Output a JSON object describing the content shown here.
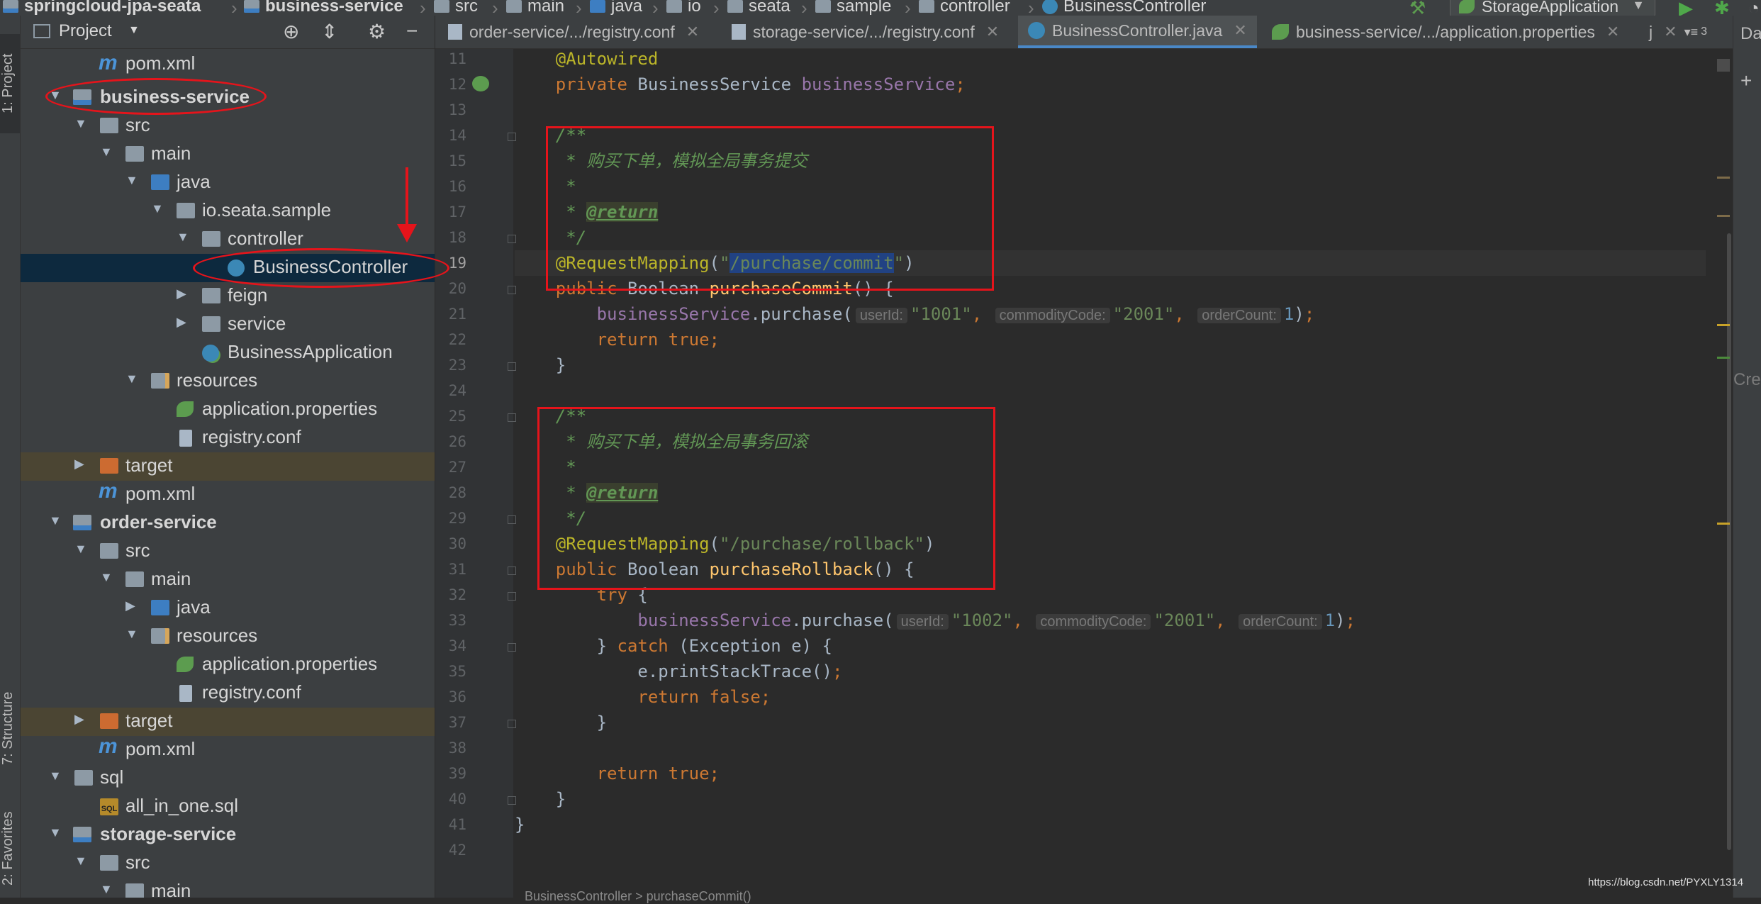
{
  "navbar": {
    "crumbs": [
      {
        "label": "springcloud-jpa-seata",
        "icon": "module-icon"
      },
      {
        "label": "business-service",
        "icon": "module-icon"
      },
      {
        "label": "src",
        "icon": "folder-icon"
      },
      {
        "label": "main",
        "icon": "folder-icon"
      },
      {
        "label": "java",
        "icon": "folder-icon"
      },
      {
        "label": "io",
        "icon": "package-icon"
      },
      {
        "label": "seata",
        "icon": "package-icon"
      },
      {
        "label": "sample",
        "icon": "package-icon"
      },
      {
        "label": "controller",
        "icon": "package-icon"
      },
      {
        "label": "BusinessController",
        "icon": "class-icon"
      }
    ],
    "run_config": "StorageApplication"
  },
  "left_strip": {
    "project_tab": "1: Project",
    "structure_tab": "7: Structure",
    "favorites_tab": "2: Favorites"
  },
  "project_panel": {
    "title": "Project",
    "tree": [
      {
        "label": "pom.xml",
        "icon": "maven-icon",
        "indent": 0
      },
      {
        "label": "business-service",
        "icon": "module-icon",
        "bold": true
      },
      {
        "label": "src",
        "icon": "folder-icon"
      },
      {
        "label": "main",
        "icon": "folder-icon"
      },
      {
        "label": "java",
        "icon": "source-folder-icon"
      },
      {
        "label": "io.seata.sample",
        "icon": "package-icon"
      },
      {
        "label": "controller",
        "icon": "package-icon"
      },
      {
        "label": "BusinessController",
        "icon": "class-icon",
        "selected": true
      },
      {
        "label": "feign",
        "icon": "package-icon"
      },
      {
        "label": "service",
        "icon": "package-icon"
      },
      {
        "label": "BusinessApplication",
        "icon": "spring-app-icon"
      },
      {
        "label": "resources",
        "icon": "resources-folder-icon"
      },
      {
        "label": "application.properties",
        "icon": "properties-icon"
      },
      {
        "label": "registry.conf",
        "icon": "file-icon"
      },
      {
        "label": "target",
        "icon": "excluded-folder-icon",
        "excluded": true
      },
      {
        "label": "pom.xml",
        "icon": "maven-icon"
      },
      {
        "label": "order-service",
        "icon": "module-icon",
        "bold": true
      },
      {
        "label": "src",
        "icon": "folder-icon"
      },
      {
        "label": "main",
        "icon": "folder-icon"
      },
      {
        "label": "java",
        "icon": "source-folder-icon"
      },
      {
        "label": "resources",
        "icon": "resources-folder-icon"
      },
      {
        "label": "application.properties",
        "icon": "properties-icon"
      },
      {
        "label": "registry.conf",
        "icon": "file-icon"
      },
      {
        "label": "target",
        "icon": "excluded-folder-icon",
        "excluded": true
      },
      {
        "label": "pom.xml",
        "icon": "maven-icon"
      },
      {
        "label": "sql",
        "icon": "folder-icon"
      },
      {
        "label": "all_in_one.sql",
        "icon": "sql-icon"
      },
      {
        "label": "storage-service",
        "icon": "module-icon",
        "bold": true
      },
      {
        "label": "src",
        "icon": "folder-icon"
      },
      {
        "label": "main",
        "icon": "folder-icon"
      }
    ]
  },
  "tabs": [
    {
      "label": "order-service/.../registry.conf",
      "icon": "file-icon"
    },
    {
      "label": "storage-service/.../registry.conf",
      "icon": "file-icon"
    },
    {
      "label": "BusinessController.java",
      "icon": "class-icon",
      "active": true
    },
    {
      "label": "business-service/.../application.properties",
      "icon": "properties-icon"
    }
  ],
  "tabs_overflow": {
    "more_label": "j",
    "count": "3"
  },
  "editor": {
    "lines": [
      {
        "n": "11",
        "segs": [
          [
            "ann",
            "    @Autowired"
          ]
        ]
      },
      {
        "n": "12",
        "segs": [
          [
            "plain",
            "    "
          ],
          [
            "kw",
            "private "
          ],
          [
            "plain",
            "BusinessService "
          ],
          [
            "fld",
            "businessService"
          ],
          [
            "kw",
            ";"
          ]
        ]
      },
      {
        "n": "13",
        "segs": []
      },
      {
        "n": "14",
        "segs": [
          [
            "doc",
            "    /**"
          ]
        ]
      },
      {
        "n": "15",
        "segs": [
          [
            "doc",
            "     * 购买下单，模拟全局事务提交"
          ]
        ]
      },
      {
        "n": "16",
        "segs": [
          [
            "doc",
            "     *"
          ]
        ]
      },
      {
        "n": "17",
        "segs": [
          [
            "doc",
            "     * "
          ],
          [
            "doctag",
            "@return"
          ]
        ]
      },
      {
        "n": "18",
        "segs": [
          [
            "doc",
            "     */"
          ]
        ]
      },
      {
        "n": "19",
        "segs": [
          [
            "ann",
            "    @RequestMapping"
          ],
          [
            "plain",
            "("
          ],
          [
            "str",
            "\""
          ],
          [
            "strsel",
            "/purchase/commit"
          ],
          [
            "str",
            "\""
          ],
          [
            "plain",
            ")"
          ]
        ]
      },
      {
        "n": "20",
        "segs": [
          [
            "plain",
            "    "
          ],
          [
            "kw",
            "public "
          ],
          [
            "plain",
            "Boolean "
          ],
          [
            "fn",
            "purchaseCommit"
          ],
          [
            "plain",
            "() {"
          ]
        ]
      },
      {
        "n": "21",
        "segs": [
          [
            "plain",
            "        "
          ],
          [
            "fld",
            "businessService"
          ],
          [
            "plain",
            ".purchase("
          ],
          [
            "hint",
            "userId:"
          ],
          [
            "str",
            "\"1001\""
          ],
          [
            "kw",
            ", "
          ],
          [
            "hint",
            "commodityCode:"
          ],
          [
            "str",
            "\"2001\""
          ],
          [
            "kw",
            ", "
          ],
          [
            "hint",
            "orderCount:"
          ],
          [
            "num",
            "1"
          ],
          [
            "plain",
            ")"
          ],
          [
            "kw",
            ";"
          ]
        ]
      },
      {
        "n": "22",
        "segs": [
          [
            "plain",
            "        "
          ],
          [
            "kw",
            "return true;"
          ]
        ]
      },
      {
        "n": "23",
        "segs": [
          [
            "plain",
            "    }"
          ]
        ]
      },
      {
        "n": "24",
        "segs": []
      },
      {
        "n": "25",
        "segs": [
          [
            "doc",
            "    /**"
          ]
        ]
      },
      {
        "n": "26",
        "segs": [
          [
            "doc",
            "     * 购买下单，模拟全局事务回滚"
          ]
        ]
      },
      {
        "n": "27",
        "segs": [
          [
            "doc",
            "     *"
          ]
        ]
      },
      {
        "n": "28",
        "segs": [
          [
            "doc",
            "     * "
          ],
          [
            "doctag",
            "@return"
          ]
        ]
      },
      {
        "n": "29",
        "segs": [
          [
            "doc",
            "     */"
          ]
        ]
      },
      {
        "n": "30",
        "segs": [
          [
            "ann",
            "    @RequestMapping"
          ],
          [
            "plain",
            "("
          ],
          [
            "str",
            "\"/purchase/rollback\""
          ],
          [
            "plain",
            ")"
          ]
        ]
      },
      {
        "n": "31",
        "segs": [
          [
            "plain",
            "    "
          ],
          [
            "kw",
            "public "
          ],
          [
            "plain",
            "Boolean "
          ],
          [
            "fn",
            "purchaseRollback"
          ],
          [
            "plain",
            "() {"
          ]
        ]
      },
      {
        "n": "32",
        "segs": [
          [
            "plain",
            "        "
          ],
          [
            "kw",
            "try "
          ],
          [
            "plain",
            "{"
          ]
        ]
      },
      {
        "n": "33",
        "segs": [
          [
            "plain",
            "            "
          ],
          [
            "fld",
            "businessService"
          ],
          [
            "plain",
            ".purchase("
          ],
          [
            "hint",
            "userId:"
          ],
          [
            "str",
            "\"1002\""
          ],
          [
            "kw",
            ", "
          ],
          [
            "hint",
            "commodityCode:"
          ],
          [
            "str",
            "\"2001\""
          ],
          [
            "kw",
            ", "
          ],
          [
            "hint",
            "orderCount:"
          ],
          [
            "num",
            "1"
          ],
          [
            "plain",
            ")"
          ],
          [
            "kw",
            ";"
          ]
        ]
      },
      {
        "n": "34",
        "segs": [
          [
            "plain",
            "        } "
          ],
          [
            "kw",
            "catch "
          ],
          [
            "plain",
            "(Exception e) {"
          ]
        ]
      },
      {
        "n": "35",
        "segs": [
          [
            "plain",
            "            e.printStackTrace()"
          ],
          [
            "kw",
            ";"
          ]
        ]
      },
      {
        "n": "36",
        "segs": [
          [
            "plain",
            "            "
          ],
          [
            "kw",
            "return false;"
          ]
        ]
      },
      {
        "n": "37",
        "segs": [
          [
            "plain",
            "        }"
          ]
        ]
      },
      {
        "n": "38",
        "segs": []
      },
      {
        "n": "39",
        "segs": [
          [
            "plain",
            "        "
          ],
          [
            "kw",
            "return true;"
          ]
        ]
      },
      {
        "n": "40",
        "segs": [
          [
            "plain",
            "    }"
          ]
        ]
      },
      {
        "n": "41",
        "segs": [
          [
            "plain",
            "}"
          ]
        ]
      },
      {
        "n": "42",
        "segs": []
      }
    ],
    "current_line": "19"
  },
  "right_strip": {
    "top_label": "Da",
    "side_label": "Cre"
  },
  "bottom_crumb": "BusinessController  >  purchaseCommit()",
  "watermark": "https://blog.csdn.net/PYXLY1314",
  "colors": {
    "annotation_red": "#e5141b",
    "selection": "#0d293e",
    "accent": "#4a88c7"
  }
}
